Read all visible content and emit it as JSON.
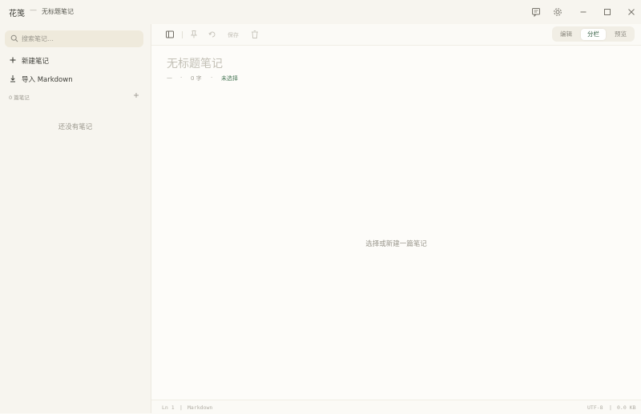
{
  "titlebar": {
    "app_name": "花笺",
    "separator": "—",
    "document_title": "无标题笔记"
  },
  "sidebar": {
    "search": {
      "placeholder": "搜索笔记…"
    },
    "actions": [
      {
        "label": "新建笔记",
        "icon": "plus-icon"
      },
      {
        "label": "导入 Markdown",
        "icon": "import-icon"
      }
    ],
    "note_count": "0 篇笔记",
    "empty_message": "还没有笔记"
  },
  "toolbar": {
    "save_label": "保存",
    "view_modes": [
      {
        "label": "编辑",
        "active": false
      },
      {
        "label": "分栏",
        "active": true
      },
      {
        "label": "预览",
        "active": false
      }
    ]
  },
  "editor": {
    "title": "无标题笔记",
    "meta": {
      "date": "—",
      "dot": "·",
      "word_count": "0 字",
      "folder": "未选择"
    },
    "empty_message": "选择或新建一篇笔记"
  },
  "statusbar": {
    "line": "Ln 1",
    "divider": "|",
    "language": "Markdown",
    "encoding": "UTF-8",
    "size": "0.0 KB"
  },
  "colors": {
    "accent": "#2f5a3e",
    "background": "#fbfaf6",
    "sidebar": "#f7f5ef"
  }
}
